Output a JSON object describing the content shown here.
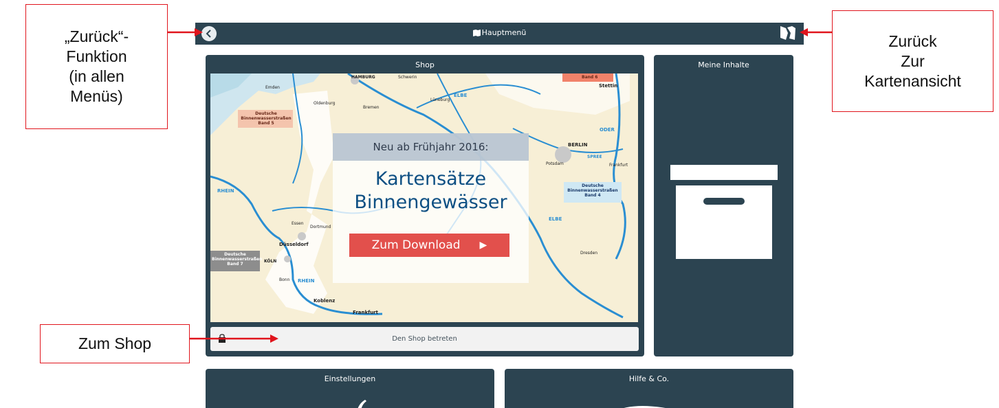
{
  "header": {
    "title": "Hauptmenü"
  },
  "shop_panel": {
    "title": "Shop",
    "promo": {
      "headline": "Neu ab Frühjahr 2016:",
      "title_line1": "Kartensätze",
      "title_line2": "Binnengewässer",
      "download_label": "Zum Download",
      "download_arrow": "▶"
    },
    "enter_label": "Den Shop betreten",
    "map_labels": {
      "band5": "Deutsche Binnenwasserstraßen Band 5",
      "band4": "Deutsche Binnenwasserstraßen Band 4",
      "band7": "Deutsche Binnenwasserstraßen Band 7",
      "band6": "Band 6",
      "hamburg": "HAMBURG",
      "schwerin": "Schwerin",
      "stettin": "Stettin",
      "bremen": "Bremen",
      "berlin": "BERLIN",
      "potsdam": "Potsdam",
      "frankfurt_oder": "Frankfurt",
      "dortmund": "Dortmund",
      "essen": "Essen",
      "duesseldorf": "Düsseldorf",
      "koeln": "KÖLN",
      "bonn": "Bonn",
      "koblenz": "Koblenz",
      "frankfurt": "Frankfurt",
      "dresden": "Dresden",
      "rhein": "RHEIN",
      "elbe": "ELBE",
      "oder": "ODER",
      "spree": "SPREE",
      "emden": "Emden",
      "oldenburg": "Oldenburg",
      "lueneburg": "Lüneburg"
    }
  },
  "contents_panel": {
    "title": "Meine Inhalte"
  },
  "settings_panel": {
    "title": "Einstellungen"
  },
  "help_panel": {
    "title": "Hilfe & Co."
  },
  "annotations": {
    "back": [
      "„Zurück“-",
      "Funktion",
      "(in allen",
      "Menüs)"
    ],
    "map": [
      "Zurück",
      "Zur",
      "Kartenansicht"
    ],
    "shop": "Zum Shop"
  },
  "colors": {
    "panel": "#2c4451",
    "accent_red": "#e2504c",
    "annotation_red": "#e0141c",
    "promo_blue": "#0d4f83"
  }
}
